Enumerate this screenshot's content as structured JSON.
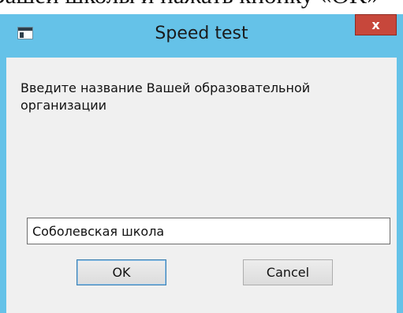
{
  "background_text": "Вашей школы и нажать кнопку «OK»",
  "window": {
    "title": "Speed test",
    "close_label": "x",
    "accent_color": "#65c2e8",
    "close_color": "#c7473b",
    "icon": "app-window-icon"
  },
  "dialog": {
    "prompt": "Введите название Вашей образовательной организации",
    "input_value": "Соболевская школа",
    "ok_label": "OK",
    "cancel_label": "Cancel"
  }
}
